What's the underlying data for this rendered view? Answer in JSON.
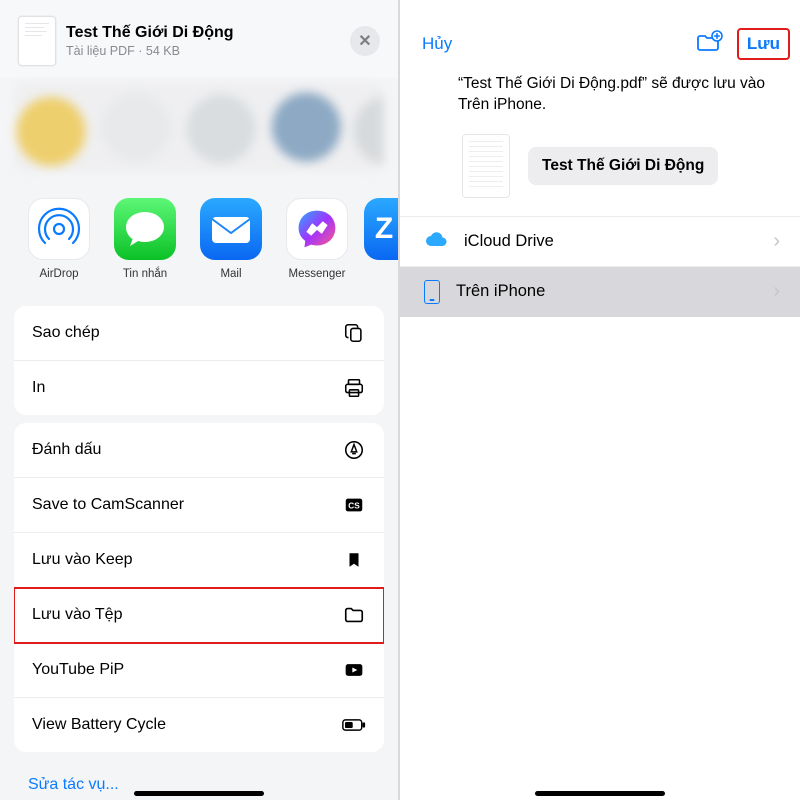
{
  "left": {
    "doc_title": "Test Thế Giới Di Động",
    "doc_sub": "Tài liệu PDF · 54 KB",
    "apps": [
      {
        "label": "AirDrop"
      },
      {
        "label": "Tin nhắn"
      },
      {
        "label": "Mail"
      },
      {
        "label": "Messenger"
      },
      {
        "label": ""
      }
    ],
    "group1": [
      {
        "label": "Sao chép",
        "icon": "copy"
      },
      {
        "label": "In",
        "icon": "print"
      }
    ],
    "group2": [
      {
        "label": "Đánh dấu",
        "icon": "markup"
      },
      {
        "label": "Save to CamScanner",
        "icon": "cs"
      },
      {
        "label": "Lưu vào Keep",
        "icon": "bookmark"
      },
      {
        "label": "Lưu vào Tệp",
        "icon": "folder",
        "highlight": true
      },
      {
        "label": "YouTube PiP",
        "icon": "yt"
      },
      {
        "label": "View Battery Cycle",
        "icon": "battery"
      }
    ],
    "edit_label": "Sửa tác vụ..."
  },
  "right": {
    "cancel": "Hủy",
    "save": "Lưu",
    "info": "“Test Thế Giới Di Động.pdf” sẽ được lưu vào Trên iPhone.",
    "file_name": "Test Thế Giới Di Động",
    "locations": [
      {
        "label": "iCloud Drive",
        "icon": "cloud",
        "selected": false
      },
      {
        "label": "Trên iPhone",
        "icon": "phone",
        "selected": true
      }
    ]
  }
}
